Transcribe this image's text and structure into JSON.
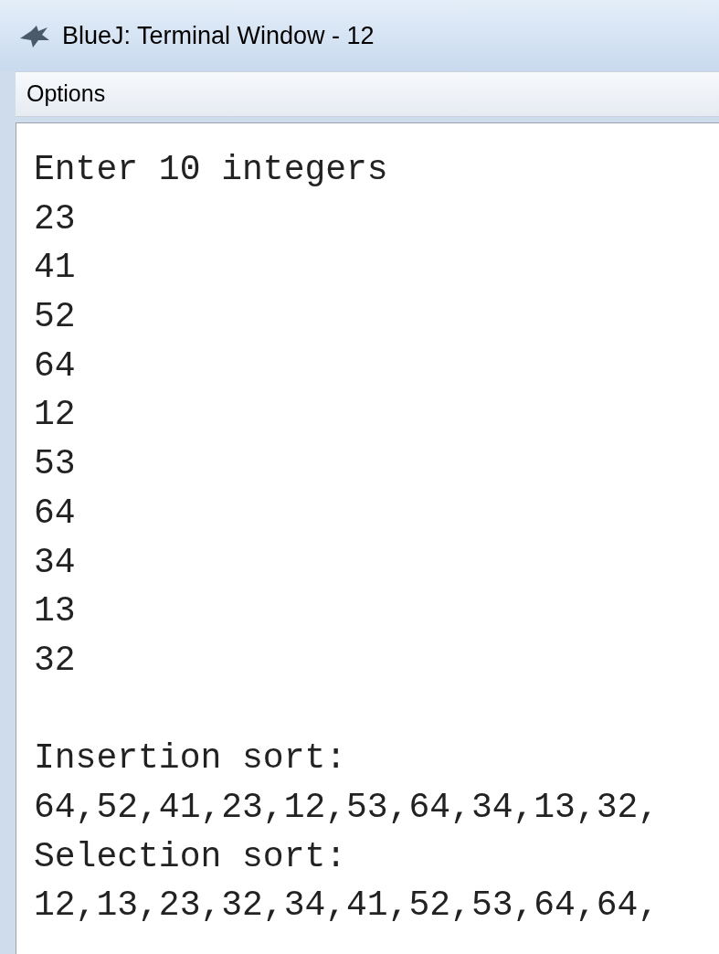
{
  "window": {
    "title": "BlueJ: Terminal Window - 12"
  },
  "menu": [
    {
      "label": "Options"
    }
  ],
  "terminal": {
    "blocks": [
      {
        "lines": [
          "Enter 10 integers",
          "23",
          "41",
          "52",
          "64",
          "12",
          "53",
          "64",
          "34",
          "13",
          "32"
        ]
      },
      {
        "lines": [
          "Insertion sort:",
          "64,52,41,23,12,53,64,34,13,32,",
          "Selection sort:",
          "12,13,23,32,34,41,52,53,64,64,"
        ]
      }
    ]
  }
}
